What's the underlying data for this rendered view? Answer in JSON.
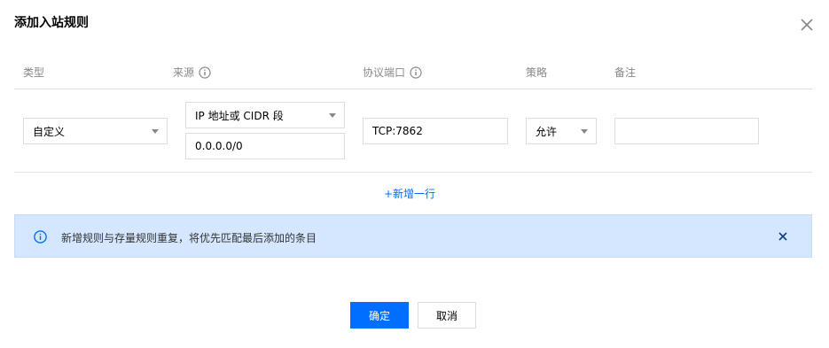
{
  "dialog": {
    "title": "添加入站规则"
  },
  "table": {
    "headers": {
      "type": "类型",
      "source": "来源",
      "port": "协议端口",
      "policy": "策略",
      "note": "备注"
    },
    "row": {
      "type_value": "自定义",
      "source_kind": "IP 地址或 CIDR 段",
      "source_value": "0.0.0.0/0",
      "port_value": "TCP:7862",
      "policy_value": "允许",
      "note_value": ""
    },
    "add_row_label": "+新增一行"
  },
  "alert": {
    "text": "新增规则与存量规则重复，将优先匹配最后添加的条目"
  },
  "footer": {
    "confirm_label": "确定",
    "cancel_label": "取消"
  },
  "colors": {
    "primary": "#006eff",
    "alert_bg": "#d5e7ff",
    "muted_text": "#888888",
    "border": "#dddddd"
  }
}
